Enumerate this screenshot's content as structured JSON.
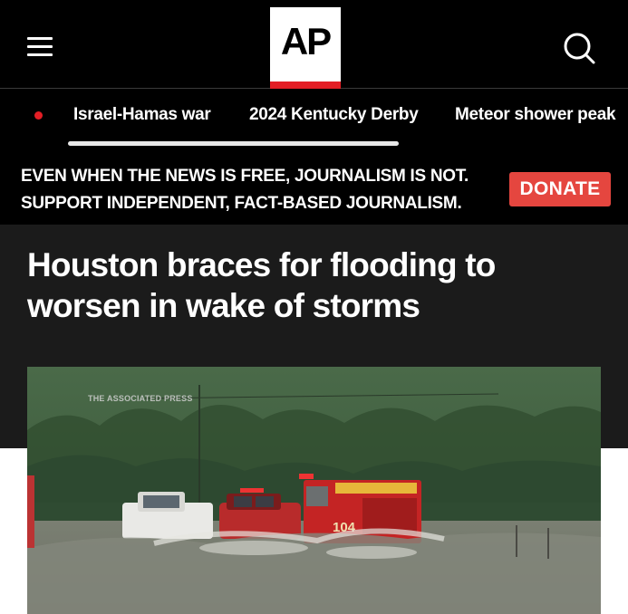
{
  "header": {
    "logo_text": "AP",
    "menu_icon": "hamburger-menu-icon",
    "search_icon": "search-icon",
    "colors": {
      "background": "#000000",
      "logo_accent": "#e31e25"
    }
  },
  "trending": {
    "items": [
      {
        "label": "Israel-Hamas war"
      },
      {
        "label": "2024 Kentucky Derby"
      },
      {
        "label": "Meteor shower peak"
      }
    ]
  },
  "donate": {
    "line1": "EVEN WHEN THE NEWS IS FREE, JOURNALISM IS NOT.",
    "line2": "SUPPORT INDEPENDENT, FACT-BASED JOURNALISM.",
    "button_label": "DONATE",
    "button_color": "#e5463f"
  },
  "article": {
    "headline": "Houston braces for flooding to worsen in wake of storms",
    "video_watermark": "THE ASSOCIATED PRESS",
    "video_truck_number": "104"
  }
}
